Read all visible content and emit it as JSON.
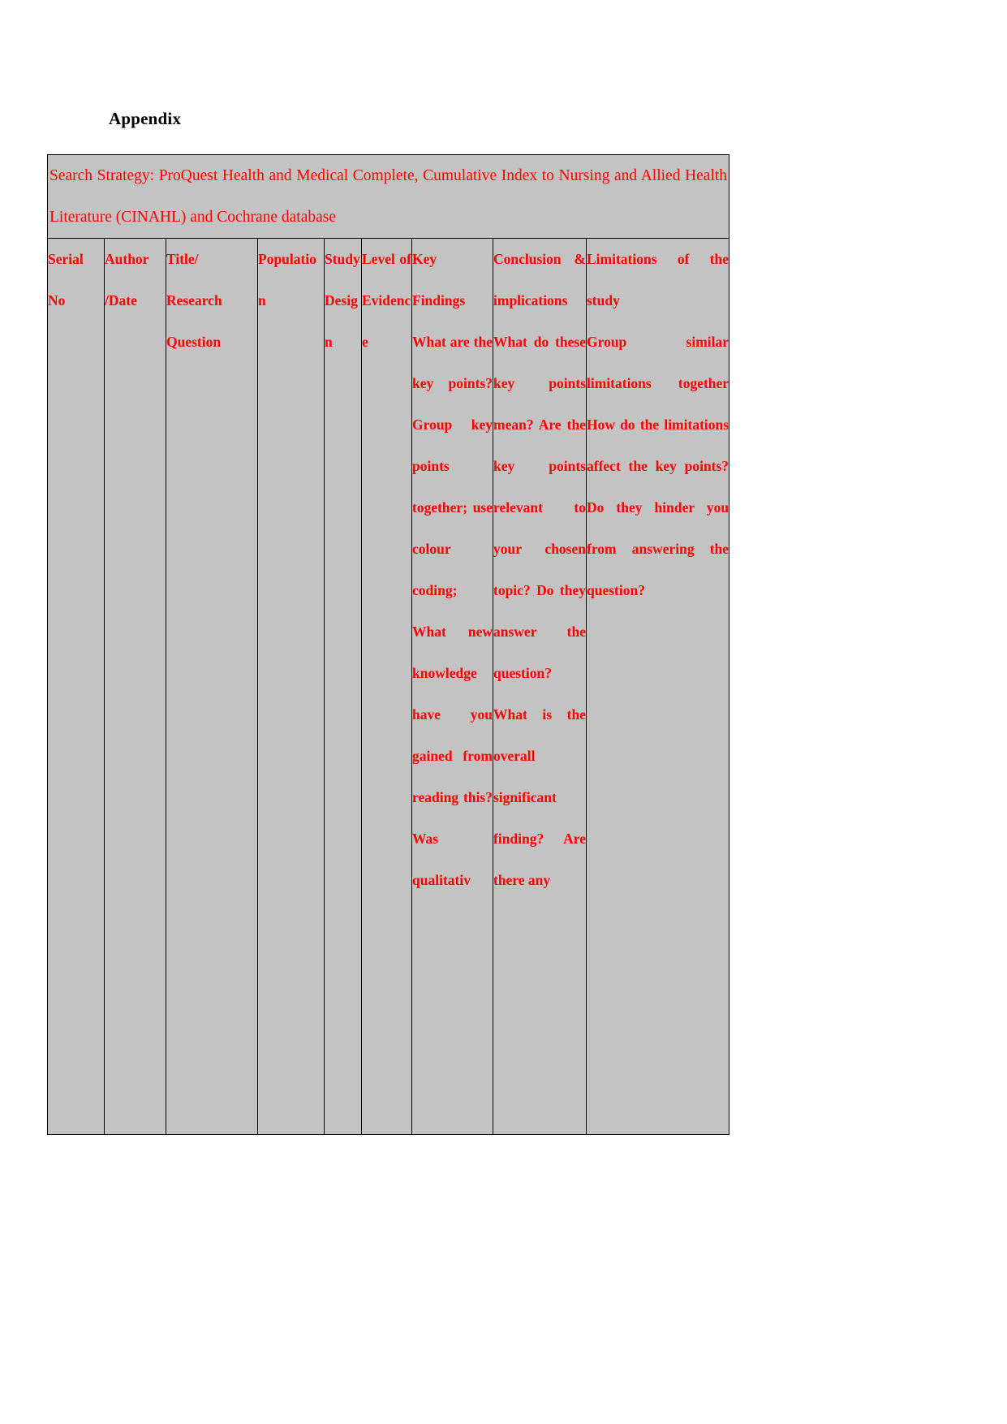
{
  "document": {
    "appendix_title": "Appendix",
    "search_strategy": "Search Strategy: ProQuest Health and Medical Complete, Cumulative Index to Nursing and Allied Health Literature (CINAHL) and Cochrane database",
    "background_color": "#c3c3c3",
    "text_color": "#ff0000",
    "title_color": "#000000",
    "border_color": "#000000"
  },
  "table": {
    "columns": [
      {
        "key": "serial_no",
        "header": "Serial No",
        "body": ""
      },
      {
        "key": "author_date",
        "header": "Author /Date",
        "body": ""
      },
      {
        "key": "title_research_question",
        "header": "Title/ Research Question",
        "body": ""
      },
      {
        "key": "population",
        "header": "Population",
        "body": ""
      },
      {
        "key": "study_design",
        "header": "Study Design",
        "body": ""
      },
      {
        "key": "level_of_evidence",
        "header": "Level of Evidence",
        "body": ""
      },
      {
        "key": "key_findings",
        "header": "Key Findings",
        "body": "What are the key points? Group key points together; use colour coding; What new knowledge have you gained from reading this? Was qualitativ"
      },
      {
        "key": "conclusion_implications",
        "header": "Conclusion & implications",
        "body": "What do these key points mean? Are the key points relevant to your chosen topic? Do they answer the question? What is the overall significant finding? Are there any"
      },
      {
        "key": "limitations",
        "header": "Limitations of the study",
        "body": "Group similar limitations together How do the limitations affect the key points? Do they hinder you from answering the question?"
      }
    ]
  }
}
